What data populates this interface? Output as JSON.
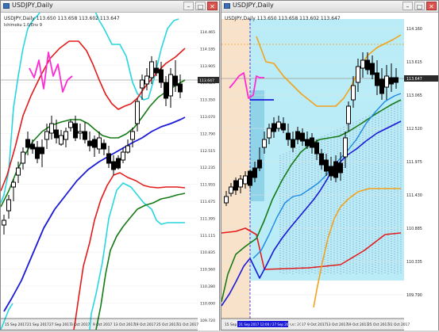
{
  "left": {
    "window_title": "USDJPY,Daily",
    "chart_header": "USDJPY,Daily 113.650 113.658 113.602 113.647",
    "indicator_label": "Ichimoku 1.0/Env 9",
    "price_labels": [
      "114.465",
      "114.185",
      "113.905",
      "113.625",
      "113.350",
      "113.070",
      "112.790",
      "112.515",
      "112.235",
      "111.955",
      "111.675",
      "111.395",
      "111.115",
      "110.835",
      "110.560",
      "110.280",
      "110.000",
      "109.720"
    ],
    "current_price": "113.647",
    "dates": [
      "15 Sep 2017",
      "21 Sep 2017",
      "27 Sep 2017",
      "3 Oct 2017",
      "9 Oct 2017",
      "13 Oct 2017",
      "19 Oct 2017",
      "25 Oct 2017",
      "31 Oct 2017"
    ]
  },
  "right": {
    "window_title": "USDJPY,Daily",
    "chart_header": "USDJPY,Daily 113.650 113.658 113.602 113.647",
    "price_labels": [
      "114.160",
      "113.615",
      "113.065",
      "112.520",
      "111.975",
      "111.430",
      "110.885",
      "110.335",
      "109.790"
    ],
    "current_price": "113.647",
    "dates": [
      "15 Sep 2017",
      "21 Sep 2017",
      "27 Sep 2017",
      "3 Oct 2017",
      "9 Oct 2017",
      "13 Oct 2017",
      "19 Oct 2017",
      "25 Oct 2017",
      "31 Oct 2017"
    ],
    "highlight_date": "21 Sep 2017 12:00 / 27 Sep 2017 00:00"
  },
  "colors": {
    "red": "#e31a1a",
    "magenta": "#ff2ad4",
    "cyan": "#27d6e0",
    "blue": "#1a1ad8",
    "green": "#157a15",
    "orange": "#f3a21b",
    "kumo": "#b9ecf6",
    "peach": "#f8e3ca"
  },
  "icons": [
    "chart-window-icon",
    "minimize-icon",
    "maximize-icon",
    "close-icon"
  ]
}
